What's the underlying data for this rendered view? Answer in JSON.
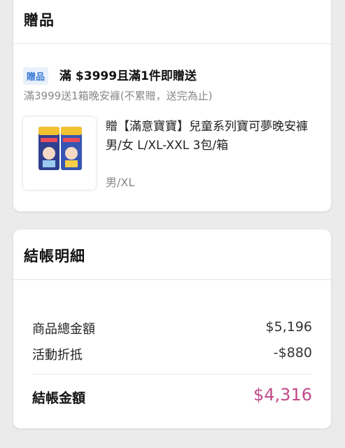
{
  "gift_card": {
    "title": "贈品",
    "tag": "贈品",
    "promo_title": "滿 $3999且滿1件即贈送",
    "promo_sub": "滿3999送1箱晚安褲(不累贈，送完為止)",
    "product_name": "贈【滿意寶寶】兒童系列寶可夢晚安褲男/女 L/XL-XXL 3包/箱",
    "product_variant": "男/XL",
    "product_image_icon": "diaper-pack-image"
  },
  "checkout_card": {
    "title": "結帳明細",
    "rows": [
      {
        "label": "商品總金額",
        "value": "$5,196"
      },
      {
        "label": "活動折抵",
        "value": "-$880"
      }
    ],
    "total_label": "結帳金額",
    "total_value": "$4,316"
  },
  "colors": {
    "background": "#ebebeb",
    "tag_bg": "#e8f1fb",
    "tag_text": "#3a7bd5",
    "total_accent": "#c04a8a"
  }
}
